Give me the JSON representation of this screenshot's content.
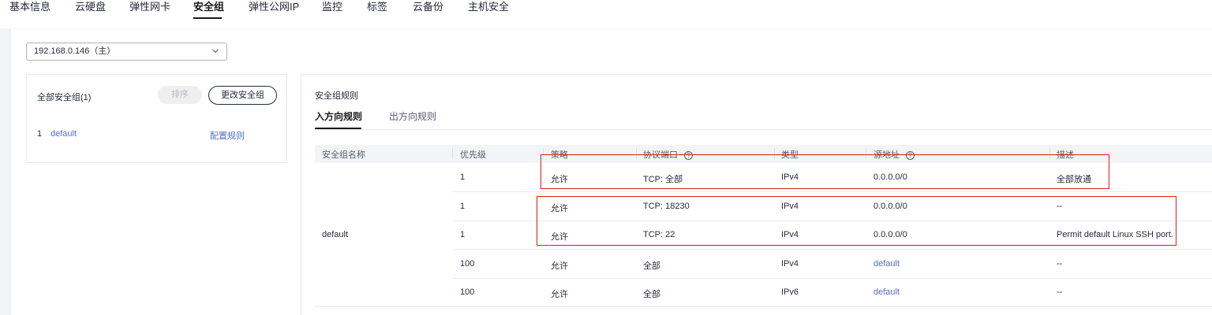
{
  "top_tabs": [
    {
      "label": "基本信息"
    },
    {
      "label": "云硬盘"
    },
    {
      "label": "弹性网卡"
    },
    {
      "label": "安全组"
    },
    {
      "label": "弹性公网IP"
    },
    {
      "label": "监控"
    },
    {
      "label": "标签"
    },
    {
      "label": "云备份"
    },
    {
      "label": "主机安全"
    }
  ],
  "active_tab": "安全组",
  "nic_select": {
    "value": "192.168.0.146（主）"
  },
  "left_panel": {
    "title": "全部安全组(1)",
    "sort_button": "排序",
    "change_button": "更改安全组",
    "groups": [
      {
        "index": "1",
        "name": "default",
        "action": "配置规则"
      }
    ]
  },
  "rules": {
    "title": "安全组规则",
    "tabs": [
      {
        "label": "入方向规则"
      },
      {
        "label": "出方向规则"
      }
    ],
    "columns": [
      "安全组名称",
      "优先级",
      "策略",
      "协议端口",
      "类型",
      "源地址",
      "描述"
    ],
    "group_name": "default",
    "rows": [
      {
        "priority": "1",
        "policy": "允许",
        "protocol_port": "TCP: 全部",
        "type": "IPv4",
        "source": "0.0.0.0/0",
        "description": "全部放通"
      },
      {
        "priority": "1",
        "policy": "允许",
        "protocol_port": "TCP: 18230",
        "type": "IPv4",
        "source": "0.0.0.0/0",
        "description": "--"
      },
      {
        "priority": "1",
        "policy": "允许",
        "protocol_port": "TCP: 22",
        "type": "IPv4",
        "source": "0.0.0.0/0",
        "description": "Permit default Linux SSH port."
      },
      {
        "priority": "100",
        "policy": "允许",
        "protocol_port": "全部",
        "type": "IPv4",
        "source": "default",
        "description": "--"
      },
      {
        "priority": "100",
        "policy": "允许",
        "protocol_port": "全部",
        "type": "IPv6",
        "source": "default",
        "description": "--"
      }
    ]
  },
  "colors": {
    "link": "#526ecc",
    "highlight": "#d91c1c"
  },
  "icons": {
    "select_arrow": "chevron-down-icon",
    "help": "help-circle-icon"
  }
}
